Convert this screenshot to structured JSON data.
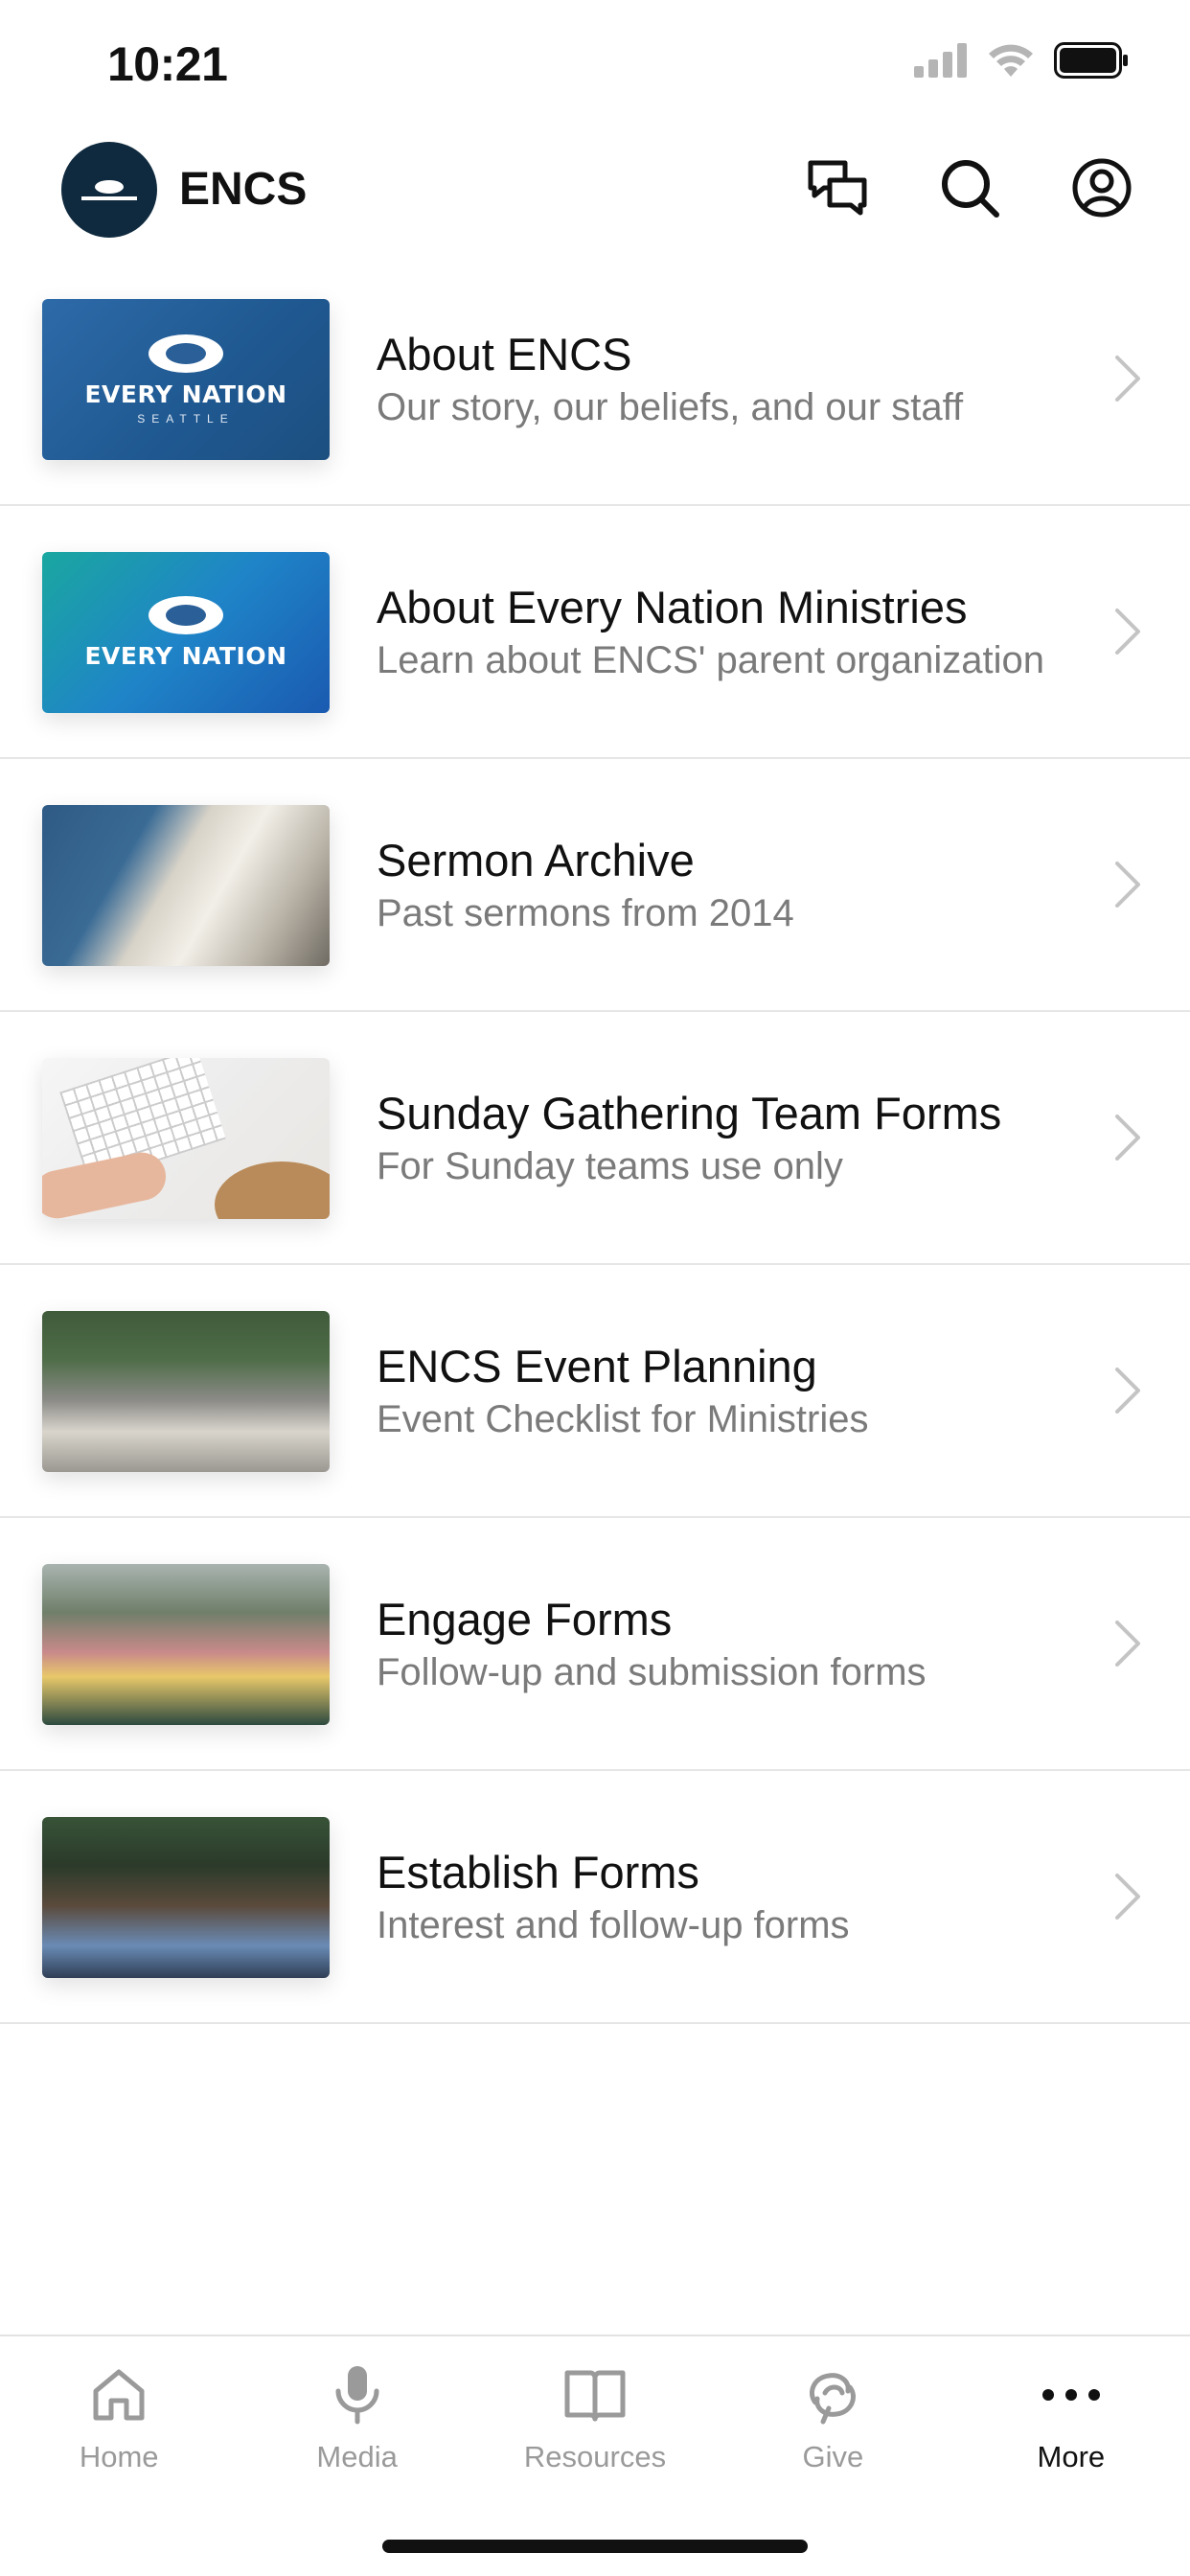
{
  "status_bar": {
    "time": "10:21"
  },
  "header": {
    "app_title": "ENCS"
  },
  "menu": {
    "items": [
      {
        "title": "About ENCS",
        "subtitle": "Our story, our beliefs, and our staff",
        "logo_word": "EVERY NATION",
        "logo_sub": "SEATTLE"
      },
      {
        "title": "About Every Nation Ministries",
        "subtitle": "Learn about ENCS' parent organization",
        "logo_word": "EVERY NATION"
      },
      {
        "title": "Sermon Archive",
        "subtitle": "Past sermons from 2014"
      },
      {
        "title": "Sunday Gathering Team Forms",
        "subtitle": "For Sunday teams use only"
      },
      {
        "title": "ENCS Event Planning",
        "subtitle": "Event Checklist for Ministries"
      },
      {
        "title": "Engage Forms",
        "subtitle": "Follow-up and submission forms"
      },
      {
        "title": "Establish Forms",
        "subtitle": "Interest and follow-up forms"
      }
    ]
  },
  "tab_bar": {
    "tabs": [
      {
        "label": "Home",
        "icon": "home-icon"
      },
      {
        "label": "Media",
        "icon": "microphone-icon"
      },
      {
        "label": "Resources",
        "icon": "book-icon"
      },
      {
        "label": "Give",
        "icon": "give-icon"
      },
      {
        "label": "More",
        "icon": "more-icon"
      }
    ],
    "active": "More"
  },
  "colors": {
    "brand_dark": "#0f2a3e",
    "text_primary": "#111111",
    "text_secondary": "#7a7a7a",
    "tab_inactive": "#9a9a9a",
    "divider": "#e6e6e6"
  }
}
